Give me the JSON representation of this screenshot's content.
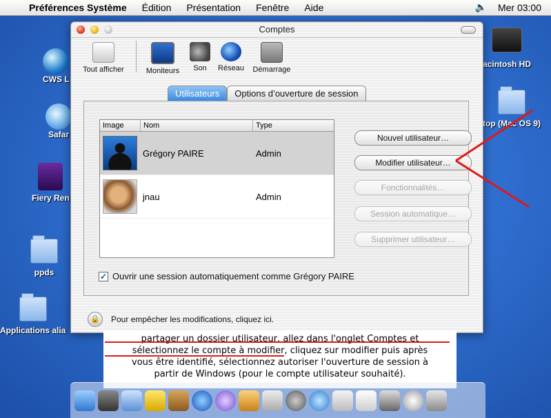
{
  "menubar": {
    "app": "Préférences Système",
    "items": [
      "Édition",
      "Présentation",
      "Fenêtre",
      "Aide"
    ],
    "clock": "Mer 03:00"
  },
  "desktop": {
    "icons": [
      {
        "label": "CWS L"
      },
      {
        "label": "Safar"
      },
      {
        "label": "Fiery Ren"
      },
      {
        "label": "ppds"
      },
      {
        "label": "Applications alia"
      },
      {
        "label": "acintosh HD"
      },
      {
        "label": "top (Mac OS 9)"
      }
    ]
  },
  "window": {
    "title": "Comptes",
    "toolbar": {
      "show_all": "Tout afficher",
      "items": [
        "Moniteurs",
        "Son",
        "Réseau",
        "Démarrage"
      ]
    },
    "tabs": [
      {
        "label": "Utilisateurs",
        "active": true
      },
      {
        "label": "Options d’ouverture de session",
        "active": false
      }
    ],
    "list": {
      "headers": [
        "Image",
        "Nom",
        "Type"
      ],
      "rows": [
        {
          "name": "Grégory PAIRE",
          "type": "Admin",
          "selected": true
        },
        {
          "name": "jnau",
          "type": "Admin",
          "selected": false
        }
      ]
    },
    "buttons": {
      "new_user": "Nouvel utilisateur…",
      "edit_user": "Modifier utilisateur…",
      "capabilities": "Fonctionnalités…",
      "auto_login": "Session automatique…",
      "delete_user": "Supprimer utilisateur…"
    },
    "auto_login_checkbox": "Ouvrir une session automatiquement comme Grégory PAIRE",
    "lock_text": "Pour empêcher les modifications, cliquez ici."
  },
  "callout": {
    "line1": "partager un dossier utilisateur, allez dans l'onglet Comptes et",
    "line2": "sélectionnez le compte à modifier, cliquez sur modifier puis après",
    "line3": "vous être identifié, sélectionnez autoriser l'ouverture de session à",
    "line4": "partir de Windows (pour le compte utilisateur souhaité)."
  },
  "colors": {
    "annotation": "#e01818",
    "tab_active": "#3a8ae0"
  }
}
